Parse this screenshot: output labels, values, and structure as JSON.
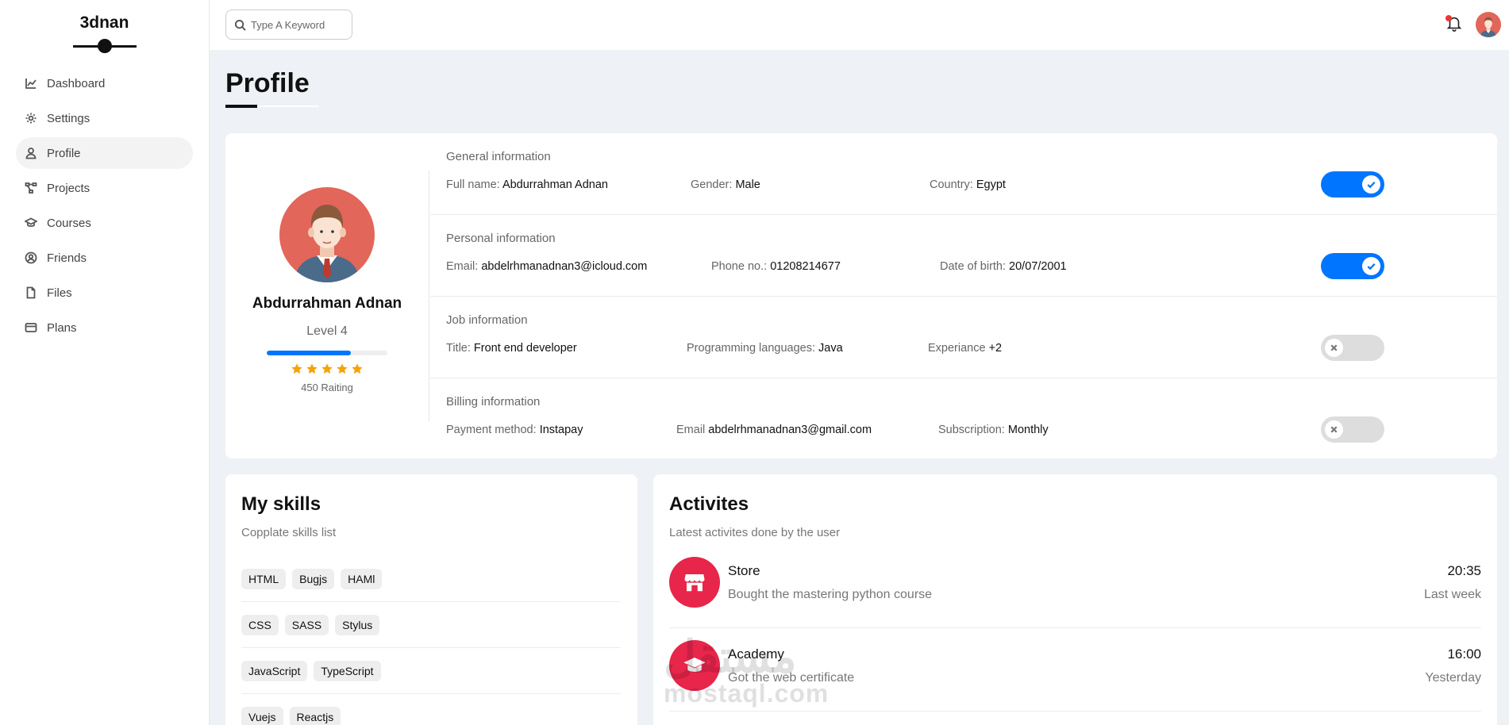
{
  "app": {
    "name": "3dnan"
  },
  "sidebar": {
    "items": [
      {
        "label": "Dashboard",
        "icon": "chart-line-icon"
      },
      {
        "label": "Settings",
        "icon": "gear-icon"
      },
      {
        "label": "Profile",
        "icon": "user-icon",
        "active": true
      },
      {
        "label": "Projects",
        "icon": "diagram-project-icon"
      },
      {
        "label": "Courses",
        "icon": "graduation-cap-icon"
      },
      {
        "label": "Friends",
        "icon": "circle-user-icon"
      },
      {
        "label": "Files",
        "icon": "file-icon"
      },
      {
        "label": "Plans",
        "icon": "credit-card-icon"
      }
    ]
  },
  "header": {
    "search_placeholder": "Type A Keyword"
  },
  "page": {
    "title": "Profile"
  },
  "profile": {
    "name": "Abdurrahman Adnan",
    "level": "Level 4",
    "level_progress": 0.7,
    "stars": 5,
    "rating": "450 Raiting"
  },
  "info": {
    "general": {
      "heading": "General information",
      "full_name_label": "Full name:",
      "full_name": "Abdurrahman Adnan",
      "gender_label": "Gender:",
      "gender": "Male",
      "country_label": "Country:",
      "country": "Egypt",
      "enabled": true
    },
    "personal": {
      "heading": "Personal information",
      "email_label": "Email:",
      "email": "abdelrhmanadnan3@icloud.com",
      "phone_label": "Phone no.:",
      "phone": "01208214677",
      "dob_label": "Date of birth:",
      "dob": "20/07/2001",
      "enabled": true
    },
    "job": {
      "heading": "Job information",
      "title_label": "Title:",
      "title": "Front end developer",
      "langs_label": "Programming languages:",
      "langs": "Java",
      "exp_label": "Experiance",
      "exp": "+2",
      "enabled": false
    },
    "billing": {
      "heading": "Billing information",
      "payment_label": "Payment method:",
      "payment": "Instapay",
      "email_label": "Email",
      "email": "abdelrhmanadnan3@gmail.com",
      "sub_label": "Subscription:",
      "sub": "Monthly",
      "enabled": false
    }
  },
  "skills": {
    "title": "My skills",
    "subtitle": "Copplate skills list",
    "rows": [
      [
        "HTML",
        "Bugjs",
        "HAMl"
      ],
      [
        "CSS",
        "SASS",
        "Stylus"
      ],
      [
        "JavaScript",
        "TypeScript"
      ],
      [
        "Vuejs",
        "Reactjs"
      ]
    ]
  },
  "activities": {
    "title": "Activites",
    "subtitle": "Latest activites done by the user",
    "items": [
      {
        "title": "Store",
        "desc": "Bought the mastering python course",
        "time": "20:35",
        "when": "Last week",
        "icon": "store-icon"
      },
      {
        "title": "Academy",
        "desc": "Got the web certificate",
        "time": "16:00",
        "when": "Yesterday",
        "icon": "graduation-cap-icon"
      }
    ]
  },
  "watermark": {
    "arabic": "مستقل",
    "latin": "mostaql.com"
  },
  "colors": {
    "accent": "#0075ff",
    "star": "#f5a20b",
    "activity_icon": "#e8254a",
    "avatar_bg": "#e2665a"
  }
}
